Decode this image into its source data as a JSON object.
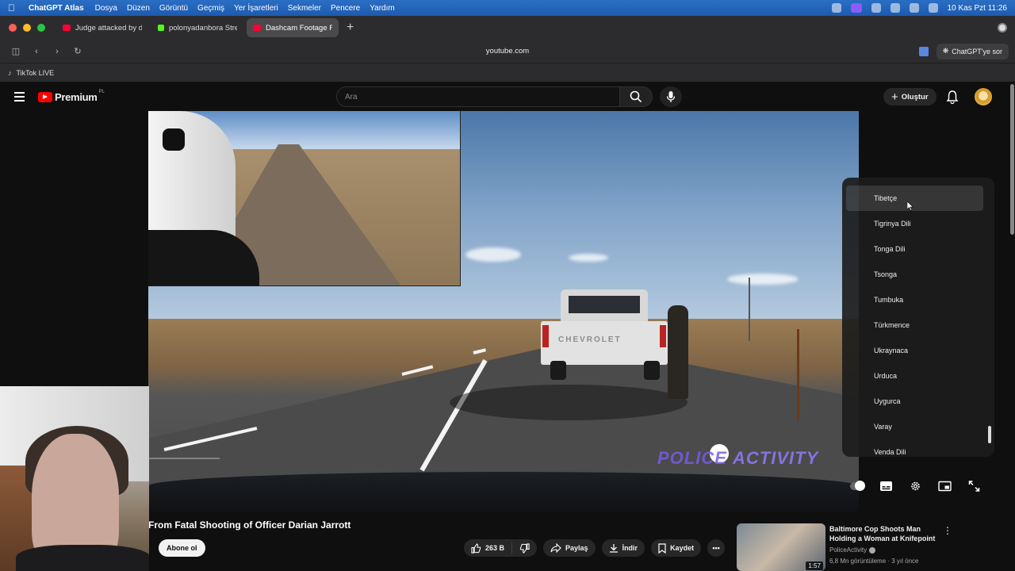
{
  "menubar": {
    "app": "ChatGPT Atlas",
    "items": [
      "Dosya",
      "Düzen",
      "Görüntü",
      "Geçmiş",
      "Yer İşaretleri",
      "Sekmeler",
      "Pencere",
      "Yardım"
    ],
    "datetime": "10 Kas Pzt  11:26"
  },
  "tabs": [
    {
      "label": "Judge attacked by de",
      "favicon_color": "#ff0033"
    },
    {
      "label": "polonyadanbora Stre",
      "favicon_color": "#53fc18"
    },
    {
      "label": "Dashcam Footage Fr",
      "favicon_color": "#ff0033"
    }
  ],
  "addressbar": {
    "url": "youtube.com",
    "ask_label": "ChatGPT'ye sor"
  },
  "bookmarks": [
    {
      "label": "TikTok LIVE"
    }
  ],
  "youtube": {
    "logo_text": "Premium",
    "logo_sup": "PL",
    "search_placeholder": "Ara",
    "create_label": "Oluştur"
  },
  "video": {
    "watermark_a": "POLICE",
    "watermark_b": "ACTIVITY",
    "truck_brand": "CHEVROLET",
    "title": "From Fatal Shooting of Officer Darian Jarrott",
    "subscribe_label": "Abone ol",
    "like_count": "263 B",
    "share_label": "Paylaş",
    "download_label": "İndir",
    "save_label": "Kaydet"
  },
  "language_menu": {
    "hovered_index": 0,
    "items": [
      "Tibetçe",
      "Tigrinya Dili",
      "Tonga Dili",
      "Tsonga",
      "Tumbuka",
      "Türkmence",
      "Ukraynaca",
      "Urduca",
      "Uygurca",
      "Varay",
      "Venda Dili"
    ]
  },
  "recommendation": {
    "title": "Baltimore Cop Shoots Man Holding a Woman at Knifepoint",
    "channel": "PoliceActivity",
    "meta": "6,8 Mn görüntüleme · 3 yıl önce",
    "duration": "1:57"
  },
  "colors": {
    "yt_red": "#ff0000",
    "bg": "#0f0f0f",
    "menubar_blue": "#1d5bb0"
  }
}
